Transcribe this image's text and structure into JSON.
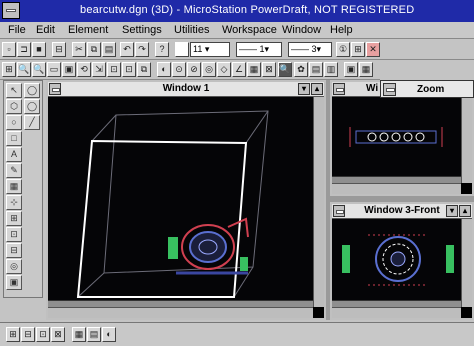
{
  "title": "bearcutw.dgn (3D) - MicroStation PowerDraft, NOT REGISTERED",
  "menu": [
    "File",
    "Edit",
    "Element",
    "Settings",
    "Utilities",
    "Workspace",
    "Window",
    "Help"
  ],
  "toolbar": {
    "level_value": "11",
    "style_value": "1",
    "weight_value": "3"
  },
  "windows": {
    "window1": {
      "title": "Window 1"
    },
    "window2": {
      "title": "Wi"
    },
    "window3": {
      "title": "Window 3-Front"
    }
  },
  "zoom_dialog": {
    "title": "Zoom"
  },
  "icons": {
    "system_menu": "minus-box-icon",
    "minimize": "down-arrow-icon",
    "maximize": "up-arrow-icon"
  },
  "colors": {
    "titlebar": "#1f2aa8",
    "view_background": "#050507",
    "cube_lines": "#ffffff",
    "part_red": "#d04050",
    "part_blue": "#5a6fd0",
    "part_green": "#38c060"
  }
}
